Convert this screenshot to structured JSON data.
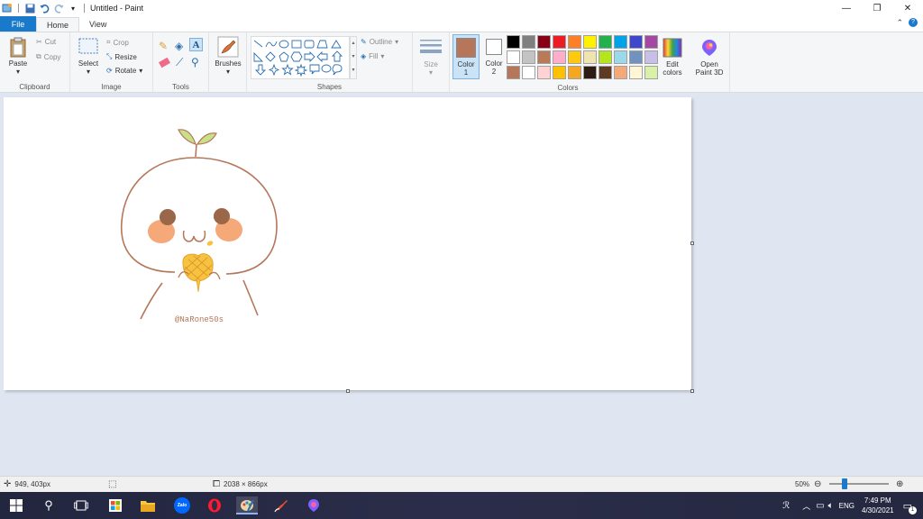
{
  "window": {
    "title": "Untitled - Paint"
  },
  "tabs": [
    {
      "label": "File"
    },
    {
      "label": "Home"
    },
    {
      "label": "View"
    }
  ],
  "ribbon": {
    "clipboard": {
      "paste": "Paste",
      "cut": "Cut",
      "copy": "Copy",
      "group_label": "Clipboard"
    },
    "image": {
      "select": "Select",
      "crop": "Crop",
      "resize": "Resize",
      "rotate": "Rotate",
      "group_label": "Image"
    },
    "tools": {
      "group_label": "Tools"
    },
    "brushes": {
      "label": "Brushes"
    },
    "shapes": {
      "outline": "Outline",
      "fill": "Fill",
      "group_label": "Shapes"
    },
    "size": {
      "label": "Size"
    },
    "colors": {
      "color1_label": "Color",
      "color1_num": "1",
      "color2_label": "Color",
      "color2_num": "2",
      "color1_value": "#b5765a",
      "edit_colors_1": "Edit",
      "edit_colors_2": "colors",
      "paint3d_1": "Open",
      "paint3d_2": "Paint 3D",
      "group_label": "Colors",
      "palette": [
        "#000000",
        "#7f7f7f",
        "#880015",
        "#ed1c24",
        "#ff7f27",
        "#fff200",
        "#22b14c",
        "#00a2e8",
        "#3f48cc",
        "#a349a4",
        "#ffffff",
        "#c3c3c3",
        "#b97a57",
        "#ffaec9",
        "#ffc90e",
        "#efe4b0",
        "#b5e61d",
        "#99d9ea",
        "#7092be",
        "#c8bfe7",
        "#b5765a",
        "#ffffff",
        "#ffd3d3",
        "#ffc000",
        "#f5a623",
        "#2b1d14",
        "#5e3a22",
        "#f5a878",
        "#fff6d8",
        "#d8f0a8"
      ]
    }
  },
  "canvas": {
    "watermark": "@NaRone50s",
    "outline_color": "#b5765a"
  },
  "status": {
    "cursor_pos": "949, 403px",
    "image_size": "2038 × 866px",
    "zoom": "50%"
  },
  "taskbar": {
    "lang": "ENG",
    "time": "7:49 PM",
    "date": "4/30/2021",
    "notif_count": "1",
    "zalo": "Zalo"
  }
}
